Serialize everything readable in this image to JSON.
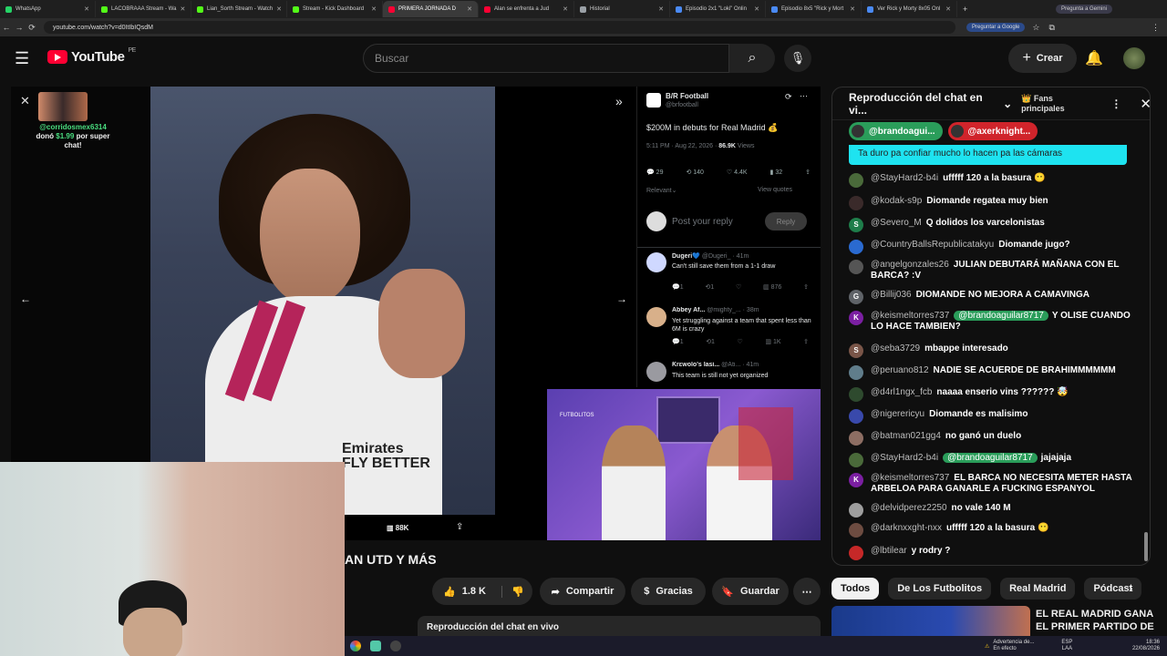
{
  "browser": {
    "tabs": [
      {
        "label": "WhatsApp",
        "color": "#25d366"
      },
      {
        "label": "LACOBRAAA Stream - Wa",
        "color": "#53fc18"
      },
      {
        "label": "Lian_Sorth Stream - Watch",
        "color": "#53fc18"
      },
      {
        "label": "Stream - Kick Dashboard",
        "color": "#53fc18"
      },
      {
        "label": "PRIMERA JORNADA D",
        "color": "#ff0033",
        "active": true
      },
      {
        "label": "Alan se enfrenta a Jud",
        "color": "#ff0033"
      },
      {
        "label": "Historial",
        "color": "#9aa0a6"
      },
      {
        "label": "Episodio 2x1 \"Loki\" Onlin",
        "color": "#4a8af4"
      },
      {
        "label": "Episodio 8x5 \"Rick y Mort",
        "color": "#4a8af4"
      },
      {
        "label": "Ver Rick y Morty 8x05 Onl",
        "color": "#4a8af4"
      }
    ],
    "gemini_label": "Pregunta a Gemini",
    "url": "youtube.com/watch?v=d0ItIbIQsdM",
    "google_label": "Preguntar a Google"
  },
  "header": {
    "logo_text": "YouTube",
    "region": "PE",
    "search_placeholder": "Buscar",
    "create_label": "Crear"
  },
  "player": {
    "super_chat_user": "@corridosmex6314",
    "super_chat_text_1": "donó",
    "super_chat_amount": "$1.99",
    "super_chat_text_2": "por super chat!",
    "views_overlay": "88K",
    "jersey_brand": "Emirates FLY BETTER"
  },
  "tweet": {
    "author": "B/R Football",
    "handle": "@brfootball",
    "text": "$200M in debuts for Real Madrid 💰",
    "time": "5:11 PM · Aug 22, 2026 ·",
    "views": "86.9K",
    "views_label": "Views",
    "stats": {
      "replies": "29",
      "retweets": "140",
      "likes": "4.4K",
      "bookmarks": "32"
    },
    "relevant_label": "Relevant",
    "view_quotes": "View quotes",
    "reply_placeholder": "Post your reply",
    "reply_button": "Reply",
    "replies": [
      {
        "name": "Dugeri💙",
        "handle": "@Dugeri_ · 41m",
        "text": "Can't still save them from a 1-1 draw",
        "likes": "876"
      },
      {
        "name": "Abbey Af...",
        "handle": "@mighty_... · 38m",
        "text": "Yet struggling against a team that spent less than 6M is crazy",
        "likes": "1K"
      },
      {
        "name": "Ƙrɛwolo's lasi...",
        "handle": "@Ati... · 41m",
        "text": "This team is still not yet organized"
      }
    ]
  },
  "cam_overlay": {
    "sign": "FUTBOLITOS"
  },
  "video": {
    "title_fragment": "AN UTD Y MÁS",
    "like_count": "1.8 K",
    "share_label": "Compartir",
    "thanks_label": "Gracias",
    "save_label": "Guardar",
    "replay_label": "Reproducción del chat en vivo"
  },
  "chat": {
    "title": "Reproducción del chat en vi...",
    "top_fans": "Fans principales",
    "pinned": [
      {
        "name": "@brandoagui...",
        "color": "#2a9d5a"
      },
      {
        "name": "@axerknight...",
        "color": "#d0242b"
      }
    ],
    "highlight": "Ta duro pa confiar mucho lo hacen pa las cámaras",
    "messages": [
      {
        "author": "@StayHard2-b4i",
        "text": "ufffff 120 a la basura 😶",
        "av": "#4a6a3a",
        "letter": ""
      },
      {
        "author": "@kodak-s9p",
        "text": "Diomande regatea muy bien",
        "av": "#3a2a2a",
        "letter": ""
      },
      {
        "author": "@Severo_M",
        "text": "Q dolidos los varcelonistas",
        "av": "#1e7d4a",
        "letter": "S"
      },
      {
        "author": "@CountryBallsRepublicatakyu",
        "text": "Diomande jugo?",
        "av": "#2a6ad0",
        "letter": ""
      },
      {
        "author": "@angelgonzales26",
        "text": "JULIAN DEBUTARÁ MAÑANA CON EL BARCA? :V",
        "av": "#555555",
        "letter": ""
      },
      {
        "author": "@Billij036",
        "text": "DIOMANDE NO MEJORA A CAMAVINGA",
        "av": "#5f6368",
        "letter": "G"
      },
      {
        "author": "@keismeltorres737",
        "mention": "@brandoaguilar8717",
        "text": "Y OLISE CUANDO LO HACE TAMBIEN?",
        "av": "#7b1fa2",
        "letter": "K"
      },
      {
        "author": "@seba3729",
        "text": "mbappe interesado",
        "av": "#795548",
        "letter": "S"
      },
      {
        "author": "@peruano812",
        "text": "NADIE SE ACUERDE DE BRAHIMMMMMM",
        "av": "#607d8b",
        "letter": ""
      },
      {
        "author": "@d4rl1ngx_fcb",
        "text": "naaaa enserio vins ?????? 🤯",
        "av": "#2e4a2e",
        "letter": ""
      },
      {
        "author": "@nigerericyu",
        "text": "Diomande es malisimo",
        "av": "#3949ab",
        "letter": ""
      },
      {
        "author": "@batman021gg4",
        "text": "no ganó un duelo",
        "av": "#8d6e63",
        "letter": ""
      },
      {
        "author": "@StayHard2-b4i",
        "mention": "@brandoaguilar8717",
        "text": "jajajaja",
        "av": "#4a6a3a",
        "letter": ""
      },
      {
        "author": "@keismeltorres737",
        "text": "EL BARCA NO NECESITA METER HASTA ARBELOA PARA GANARLE A FUCKING ESPANYOL",
        "av": "#7b1fa2",
        "letter": "K"
      },
      {
        "author": "@delvidperez2250",
        "text": "no vale 140 M",
        "av": "#9e9e9e",
        "letter": ""
      },
      {
        "author": "@darknxxght-nxx",
        "text": "ufffff 120 a la basura 😶",
        "av": "#6d4c41",
        "letter": ""
      },
      {
        "author": "@lbtilear",
        "text": "y rodry ?",
        "av": "#c62828",
        "letter": ""
      }
    ]
  },
  "chips": [
    "Todos",
    "De Los Futbolitos",
    "Real Madrid",
    "Pódcast"
  ],
  "recommendation": {
    "title": "EL REAL MADRID GANA EL PRIMER PARTIDO DE"
  },
  "taskbar": {
    "warning_title": "Advertencia de...",
    "warning_sub": "En efecto",
    "lang": "ESP",
    "lang_sub": "LAA",
    "time": "18:36",
    "date": "22/08/2026"
  }
}
